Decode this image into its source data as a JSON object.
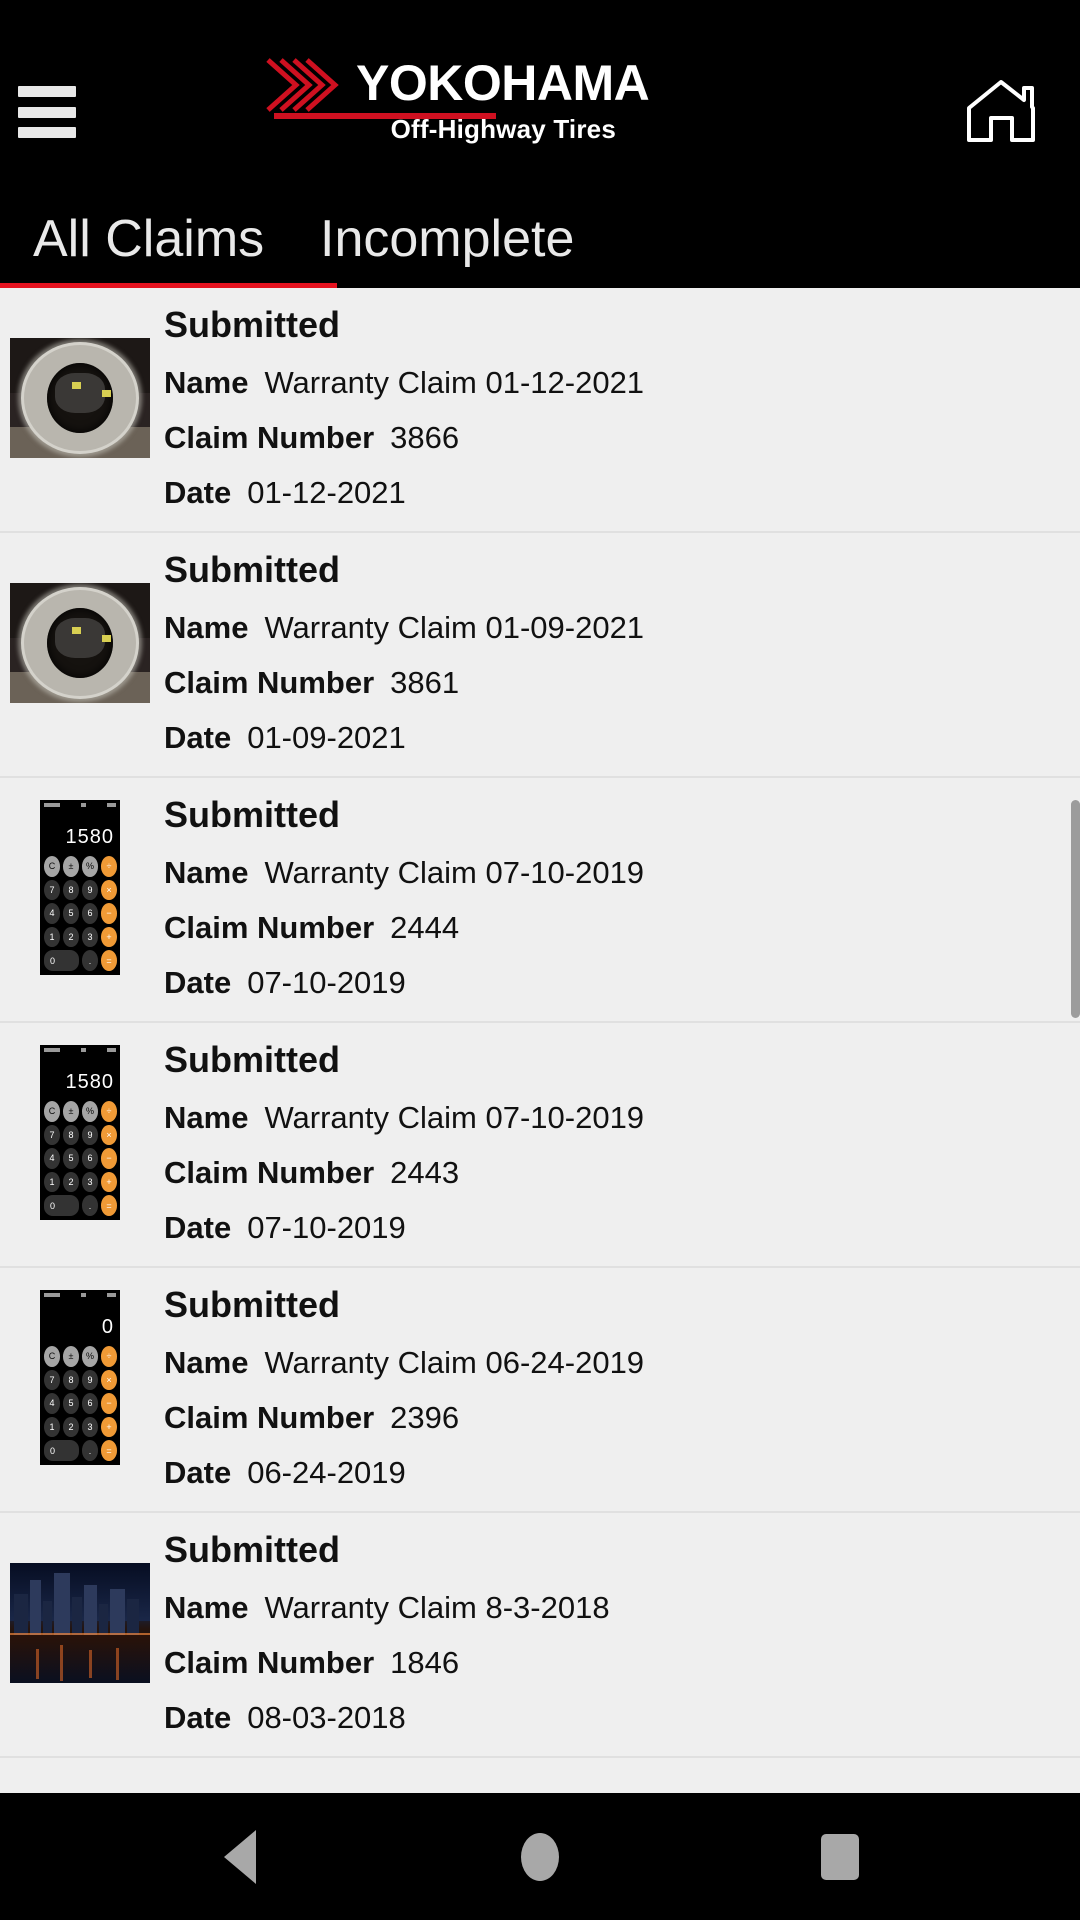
{
  "app": {
    "brand_name": "YOKOHAMA",
    "brand_tagline": "Off-Highway Tires",
    "accent_red": "#e5121f",
    "logo_red": "#cf1020",
    "header_bg": "#000000",
    "list_bg": "#efefef"
  },
  "header": {
    "menu_icon": "hamburger-menu-icon",
    "home_icon": "home-icon"
  },
  "tabs": [
    {
      "label": "All Claims",
      "active": true
    },
    {
      "label": "Incomplete",
      "active": false
    }
  ],
  "labels": {
    "name": "Name",
    "claim_number": "Claim Number",
    "date": "Date"
  },
  "claims": [
    {
      "status": "Submitted",
      "name": "Warranty Claim 01-12-2021",
      "claim_number": "3866",
      "date": "01-12-2021",
      "thumbnail": "tire-photo"
    },
    {
      "status": "Submitted",
      "name": "Warranty Claim 01-09-2021",
      "claim_number": "3861",
      "date": "01-09-2021",
      "thumbnail": "tire-photo"
    },
    {
      "status": "Submitted",
      "name": "Warranty Claim 07-10-2019",
      "claim_number": "2444",
      "date": "07-10-2019",
      "thumbnail": "calculator-screenshot",
      "calculator_display": "1580"
    },
    {
      "status": "Submitted",
      "name": "Warranty Claim 07-10-2019",
      "claim_number": "2443",
      "date": "07-10-2019",
      "thumbnail": "calculator-screenshot",
      "calculator_display": "1580"
    },
    {
      "status": "Submitted",
      "name": "Warranty Claim 06-24-2019",
      "claim_number": "2396",
      "date": "06-24-2019",
      "thumbnail": "calculator-screenshot",
      "calculator_display": "0"
    },
    {
      "status": "Submitted",
      "name": "Warranty Claim 8-3-2018",
      "claim_number": "1846",
      "date": "08-03-2018",
      "thumbnail": "city-skyline-photo"
    }
  ],
  "calculator_keys": {
    "row1": [
      "C",
      "±",
      "%",
      "÷"
    ],
    "row2": [
      "7",
      "8",
      "9",
      "×"
    ],
    "row3": [
      "4",
      "5",
      "6",
      "−"
    ],
    "row4": [
      "1",
      "2",
      "3",
      "+"
    ],
    "row5": [
      "0",
      ".",
      "="
    ]
  },
  "navbar": {
    "back": "back-triangle-icon",
    "home": "home-circle-icon",
    "recents": "recents-square-icon"
  }
}
